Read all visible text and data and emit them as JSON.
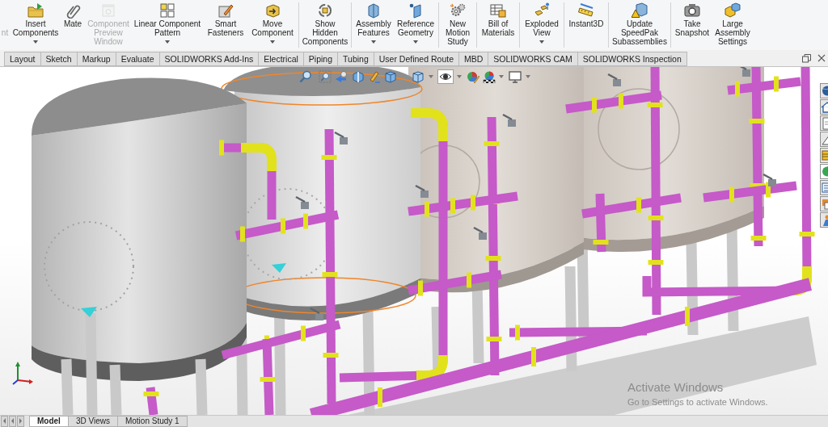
{
  "command_manager": {
    "groups": [
      {
        "items": [
          {
            "label": "nt",
            "disabled": true,
            "dropdown": false
          },
          {
            "label": "Insert Components",
            "disabled": false,
            "dropdown": true
          },
          {
            "label": "Mate",
            "disabled": false,
            "dropdown": false
          },
          {
            "label": "Component Preview Window",
            "disabled": true,
            "dropdown": false
          },
          {
            "label": "Linear Component Pattern",
            "disabled": false,
            "dropdown": true
          },
          {
            "label": "Smart Fasteners",
            "disabled": false,
            "dropdown": false
          },
          {
            "label": "Move Component",
            "disabled": false,
            "dropdown": true
          }
        ]
      },
      {
        "items": [
          {
            "label": "Show Hidden Components",
            "disabled": false,
            "dropdown": false
          }
        ]
      },
      {
        "items": [
          {
            "label": "Assembly Features",
            "disabled": false,
            "dropdown": true
          },
          {
            "label": "Reference Geometry",
            "disabled": false,
            "dropdown": true
          }
        ]
      },
      {
        "items": [
          {
            "label": "New Motion Study",
            "disabled": false,
            "dropdown": false
          }
        ]
      },
      {
        "items": [
          {
            "label": "Bill of Materials",
            "disabled": false,
            "dropdown": false
          }
        ]
      },
      {
        "items": [
          {
            "label": "Exploded View",
            "disabled": false,
            "dropdown": true
          }
        ]
      },
      {
        "items": [
          {
            "label": "Instant3D",
            "disabled": false,
            "dropdown": false
          }
        ]
      },
      {
        "items": [
          {
            "label": "Update SpeedPak Subassemblies",
            "disabled": false,
            "dropdown": false
          }
        ]
      },
      {
        "items": [
          {
            "label": "Take Snapshot",
            "disabled": false,
            "dropdown": false
          },
          {
            "label": "Large Assembly Settings",
            "disabled": false,
            "dropdown": false
          }
        ]
      }
    ]
  },
  "tabs": [
    {
      "label": "Layout",
      "selected": false
    },
    {
      "label": "Sketch",
      "selected": false
    },
    {
      "label": "Markup",
      "selected": false
    },
    {
      "label": "Evaluate",
      "selected": false
    },
    {
      "label": "SOLIDWORKS Add-Ins",
      "selected": false
    },
    {
      "label": "Electrical",
      "selected": false
    },
    {
      "label": "Piping",
      "selected": false
    },
    {
      "label": "Tubing",
      "selected": false
    },
    {
      "label": "User Defined Route",
      "selected": false
    },
    {
      "label": "MBD",
      "selected": false
    },
    {
      "label": "SOLIDWORKS CAM",
      "selected": false
    },
    {
      "label": "SOLIDWORKS Inspection",
      "selected": false
    }
  ],
  "activation_notice": {
    "title": "Activate Windows",
    "message": "Go to Settings to activate Windows."
  },
  "bottom_tabs": [
    {
      "label": "Model",
      "selected": true
    },
    {
      "label": "3D Views",
      "selected": false
    },
    {
      "label": "Motion Study 1",
      "selected": false
    }
  ]
}
